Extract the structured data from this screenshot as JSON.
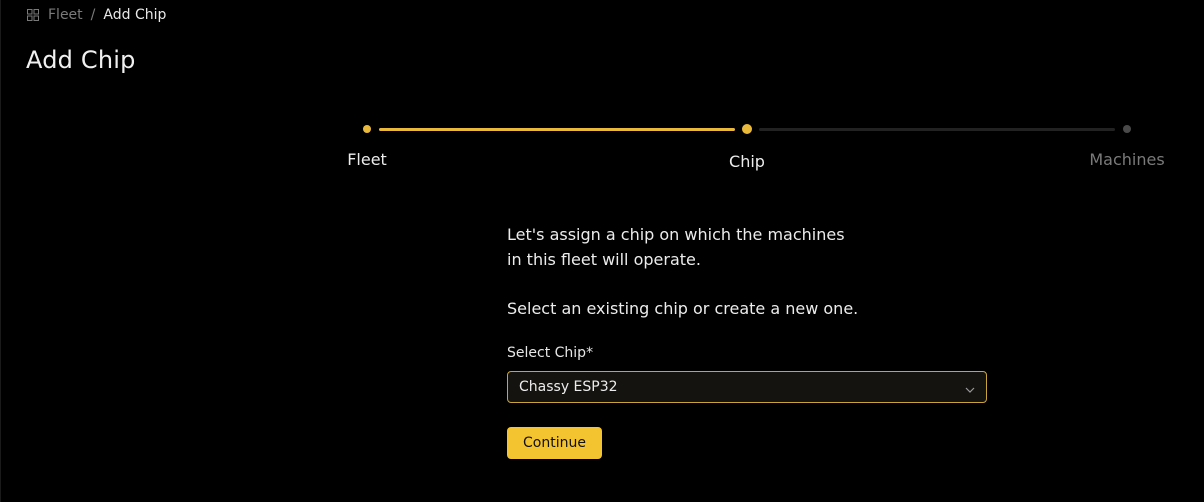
{
  "breadcrumb": {
    "icon": "grid-icon",
    "parent": "Fleet",
    "separator": "/",
    "current": "Add Chip"
  },
  "page_title": "Add Chip",
  "stepper": {
    "steps": [
      {
        "label": "Fleet",
        "state": "completed"
      },
      {
        "label": "Chip",
        "state": "active"
      },
      {
        "label": "Machines",
        "state": "pending"
      }
    ]
  },
  "form": {
    "intro": "Let's assign a chip on which the machines in this fleet will operate.",
    "instruction": "Select an existing chip or create a new one.",
    "select_label": "Select Chip*",
    "select_value": "Chassy ESP32",
    "continue_label": "Continue"
  },
  "colors": {
    "accent": "#e9b93c",
    "button": "#f4c430",
    "background": "#000000",
    "inactive": "#3a3a3a"
  }
}
